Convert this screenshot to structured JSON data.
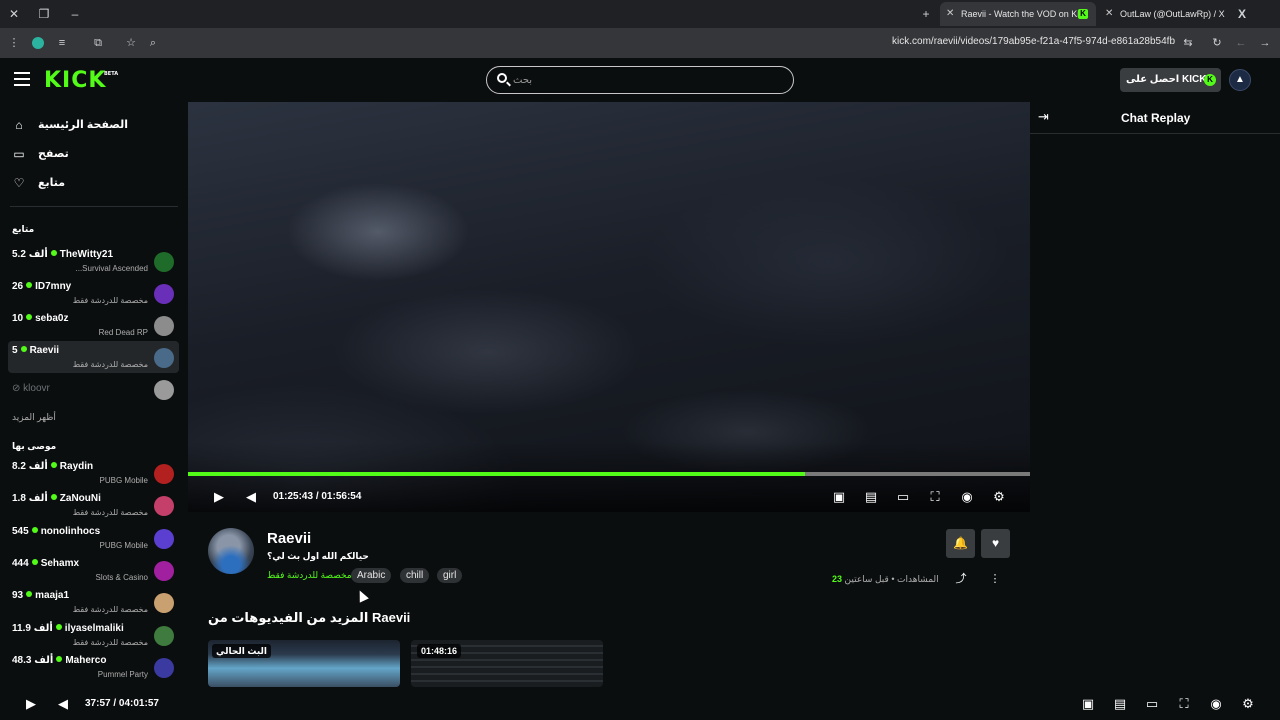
{
  "browser": {
    "tabs": [
      {
        "title": "Raevii - Watch the VOD on Kick",
        "active": true,
        "favicon": "K"
      },
      {
        "title": "OutLaw (@OutLawRp) / X",
        "active": false,
        "favicon": "X"
      }
    ],
    "url": "kick.com/raevii/videos/179ab95e-f21a-47f5-974d-e861a28b54fb"
  },
  "header": {
    "logo": "KICK",
    "logo_badge": "BETA",
    "search_placeholder": "بحث",
    "kicks_button": "احصل على KICKs",
    "kicks_badge": "K"
  },
  "sidebar": {
    "nav": [
      {
        "label": "الصفحة الرئيسية",
        "icon": "home-icon",
        "glyph": "⌂"
      },
      {
        "label": "تصفح",
        "icon": "browse-icon",
        "glyph": "▭"
      },
      {
        "label": "متابع",
        "icon": "heart-icon",
        "glyph": "♡"
      }
    ],
    "following_title": "متابع",
    "following": [
      {
        "name": "TheWitty21",
        "viewers": "5.2 ألف",
        "category": "Survival Ascended...",
        "avatar_color": "#1f6b2a"
      },
      {
        "name": "ID7mny",
        "viewers": "26",
        "category": "مخصصة للدردشة فقط",
        "avatar_color": "#6a2fb8"
      },
      {
        "name": "seba0z",
        "viewers": "10",
        "category": "Red Dead RP",
        "avatar_color": "#8c8c8c"
      },
      {
        "name": "Raevii",
        "viewers": "5",
        "category": "مخصصة للدردشة فقط",
        "avatar_color": "#4a6a8a"
      }
    ],
    "offline_channel": "kloovr",
    "show_more": "أظهر المزيد",
    "recommended_title": "موصى بها",
    "recommended": [
      {
        "name": "Raydin",
        "viewers": "8.2 ألف",
        "category": "PUBG Mobile",
        "avatar_color": "#b32020"
      },
      {
        "name": "ZaNouNi",
        "viewers": "1.8 ألف",
        "category": "مخصصة للدردشة فقط",
        "avatar_color": "#c4406a"
      },
      {
        "name": "nonolinhocs",
        "viewers": "545",
        "category": "PUBG Mobile",
        "avatar_color": "#5b3fd1"
      },
      {
        "name": "Sehamx",
        "viewers": "444",
        "category": "Slots & Casino",
        "avatar_color": "#a020a0"
      },
      {
        "name": "maaja1",
        "viewers": "93",
        "category": "مخصصة للدردشة فقط",
        "avatar_color": "#c9a070"
      },
      {
        "name": "ilyaselmaliki",
        "viewers": "11.9 ألف",
        "category": "مخصصة للدردشة فقط",
        "avatar_color": "#3f7a3f"
      },
      {
        "name": "Maherco",
        "viewers": "48.3 ألف",
        "category": "Pummel Party",
        "avatar_color": "#3a3aa0"
      }
    ]
  },
  "player": {
    "current_time": "01:25:43",
    "duration": "01:56:54",
    "progress_fraction": 0.733,
    "separator": "/"
  },
  "chat": {
    "title": "Chat Replay"
  },
  "stream": {
    "streamer": "Raevii",
    "title": "حيالكم الله اول بث لي؟",
    "category": "مخصصة للدردشة فقط",
    "tags": [
      "Arabic",
      "chill",
      "girl"
    ],
    "views_label": "المشاهدات",
    "views": "23",
    "time_ago": "قبل ساعتين",
    "bullet": "•"
  },
  "more_videos": {
    "title": "المزيد من الفيديوهات من Raevii",
    "items": [
      {
        "badge": "البث الحالي"
      },
      {
        "badge": "01:48:16"
      }
    ]
  },
  "outer_player": {
    "current_time": "37:57",
    "duration": "04:01:57",
    "separator": "/"
  },
  "colors": {
    "accent": "#53fc18",
    "background": "#0b0e0f",
    "panel": "#24272a"
  }
}
